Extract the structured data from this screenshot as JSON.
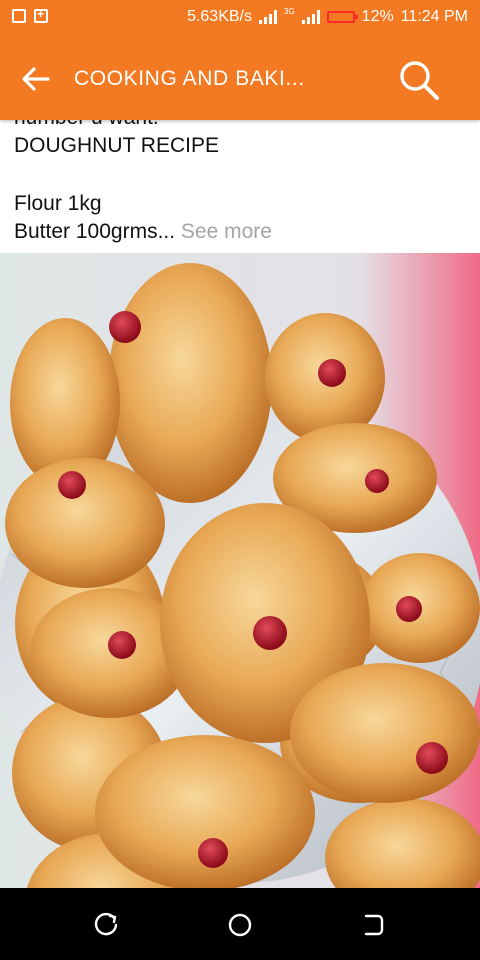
{
  "status_bar": {
    "speed": "5.63KB/s",
    "network": "3G",
    "battery": "12%",
    "time": "11:24 PM",
    "battery_color": "#ff2a2a"
  },
  "app_bar": {
    "title": "COOKING AND BAKI...",
    "accent_color": "#f37a22",
    "back_icon": "arrow-back-icon",
    "search_icon": "search-icon"
  },
  "post": {
    "line_partial": "number u want.",
    "heading": "DOUGHNUT RECIPE",
    "ingredient1": "Flour 1kg",
    "ingredient2": "Butter 100grms...",
    "see_more": "See more"
  },
  "image": {
    "icon": "jam-doughnuts-photo"
  },
  "nav_bar": {
    "icons": [
      "recents-icon",
      "home-icon",
      "back-icon"
    ]
  }
}
